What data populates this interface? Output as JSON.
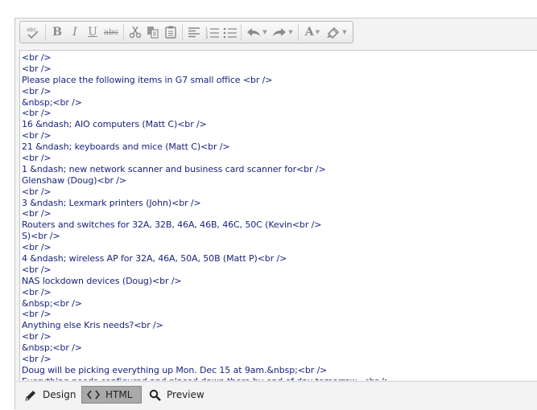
{
  "toolbar": {
    "buttons": [
      {
        "name": "spellcheck",
        "icon": "spellcheck-icon",
        "glyph": "abc"
      },
      {
        "name": "bold",
        "icon": "bold-icon",
        "glyph": "B"
      },
      {
        "name": "italic",
        "icon": "italic-icon",
        "glyph": "I"
      },
      {
        "name": "underline",
        "icon": "underline-icon",
        "glyph": "U"
      },
      {
        "name": "strikethrough",
        "icon": "strikethrough-icon",
        "glyph": "abc"
      },
      {
        "name": "cut",
        "icon": "scissors-icon"
      },
      {
        "name": "copy",
        "icon": "copy-icon"
      },
      {
        "name": "paste",
        "icon": "paste-icon"
      },
      {
        "name": "align-left",
        "icon": "align-left-icon"
      },
      {
        "name": "numbered-list",
        "icon": "numbered-list-icon"
      },
      {
        "name": "bullet-list",
        "icon": "bullet-list-icon"
      },
      {
        "name": "undo",
        "icon": "undo-icon"
      },
      {
        "name": "redo",
        "icon": "redo-icon"
      },
      {
        "name": "font-color",
        "icon": "font-color-icon",
        "glyph": "A"
      },
      {
        "name": "highlight",
        "icon": "highlight-icon"
      }
    ]
  },
  "editor": {
    "lines": [
      "<br />",
      "<br />",
      "Please place the following items in G7 small office <br />",
      "<br />",
      "&nbsp;<br />",
      "<br />",
      "16 &ndash; AIO computers (Matt C)<br />",
      "<br />",
      "21 &ndash; keyboards and mice (Matt C)<br />",
      "<br />",
      "1 &ndash; new network scanner and business card scanner for<br />",
      "Glenshaw (Doug)<br />",
      "<br />",
      "3 &ndash; Lexmark printers (John)<br />",
      "<br />",
      "Routers and switches for 32A, 32B, 46A, 46B, 46C, 50C (Kevin<br />",
      "S)<br />",
      "<br />",
      "4 &ndash; wireless AP for 32A, 46A, 50A, 50B (Matt P)<br />",
      "<br />",
      "NAS lockdown devices (Doug)<br />",
      "<br />",
      "&nbsp;<br />",
      "<br />",
      "Anything else Kris needs?<br />",
      "<br />",
      "&nbsp;<br />",
      "<br />",
      "Doug will be picking everything up Mon. Dec 15 at 9am.&nbsp;<br />",
      "Everything needs configured and placed down there by end of day tomorrow. <br />"
    ]
  },
  "modes": {
    "design": {
      "label": "Design",
      "icon": "pencil-icon"
    },
    "html": {
      "label": "HTML",
      "icon": "code-icon",
      "active": true
    },
    "preview": {
      "label": "Preview",
      "icon": "magnifier-icon"
    }
  },
  "colors": {
    "code_text": "#1a237e",
    "active_tab_bg": "#a9a9a9",
    "toolbar_icon": "#8a8a8a"
  }
}
